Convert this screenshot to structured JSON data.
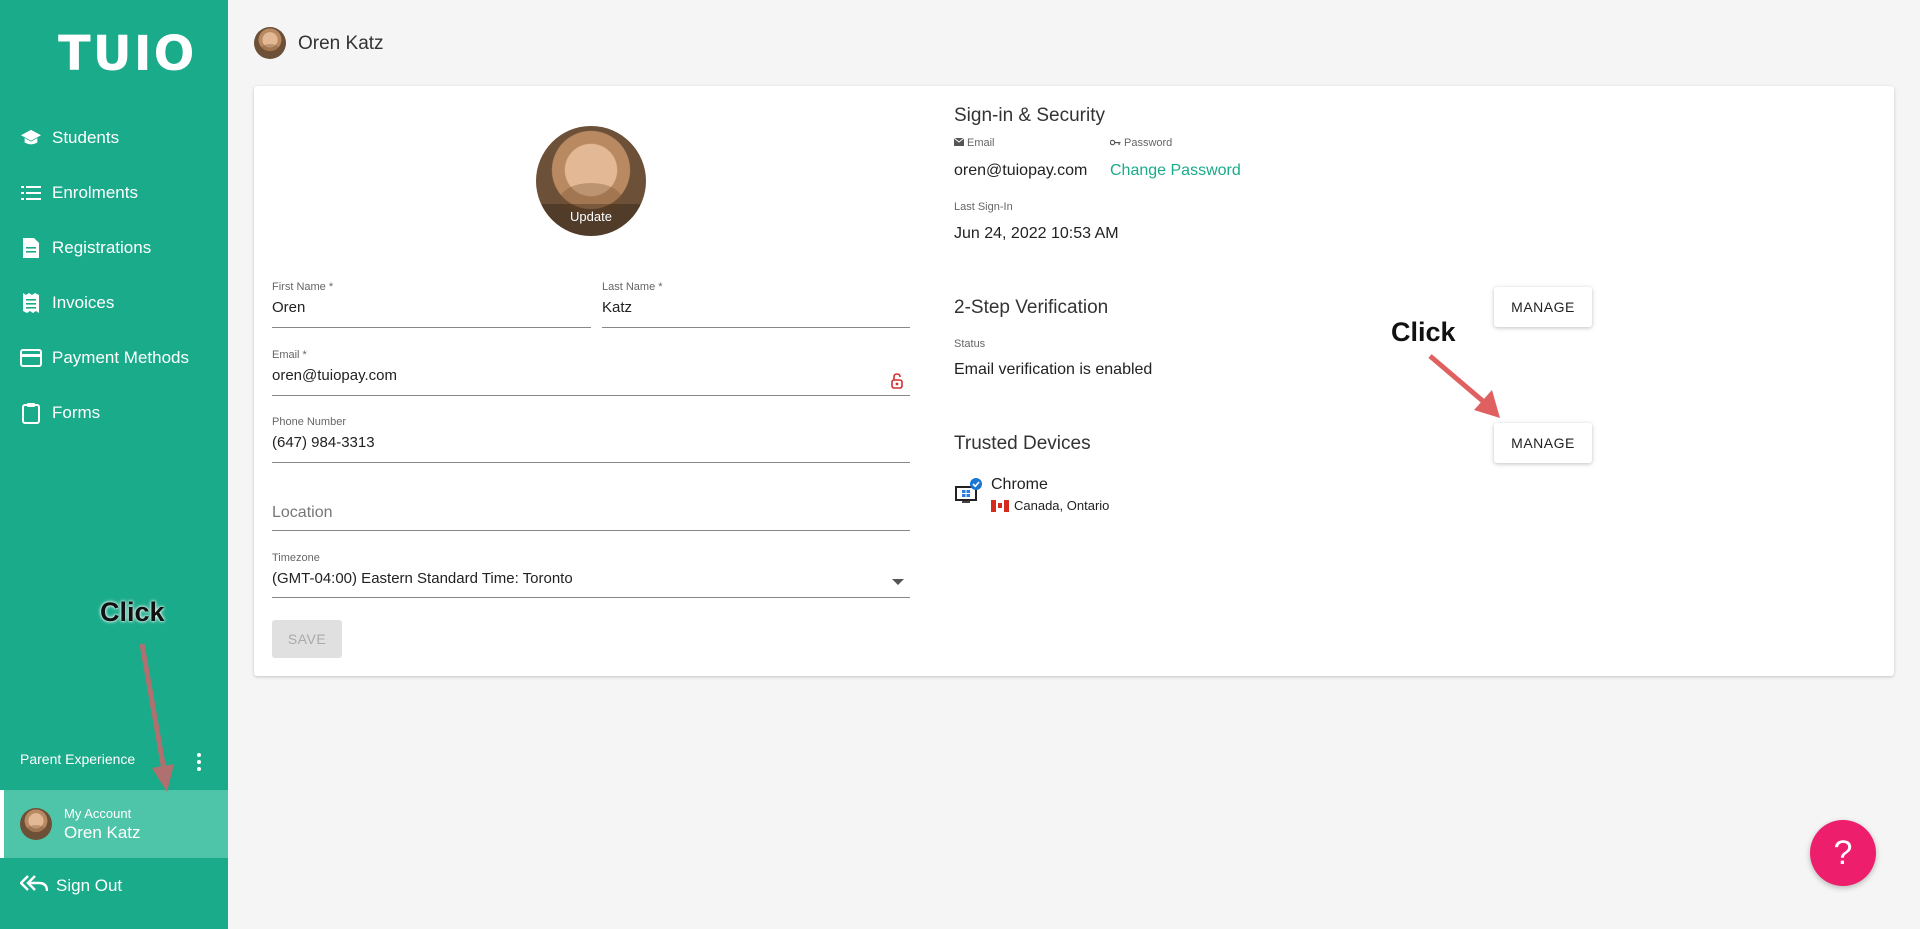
{
  "brand": {
    "logo": "TUIO"
  },
  "sidebar": {
    "items": [
      {
        "label": "Students",
        "icon": "graduation-cap-icon"
      },
      {
        "label": "Enrolments",
        "icon": "list-icon"
      },
      {
        "label": "Registrations",
        "icon": "document-icon"
      },
      {
        "label": "Invoices",
        "icon": "receipt-icon"
      },
      {
        "label": "Payment Methods",
        "icon": "credit-card-icon"
      },
      {
        "label": "Forms",
        "icon": "clipboard-icon"
      }
    ],
    "parent_experience": "Parent Experience",
    "account": {
      "caption": "My Account",
      "name": "Oren Katz"
    },
    "sign_out": "Sign Out"
  },
  "header": {
    "name": "Oren Katz"
  },
  "profile": {
    "update_label": "Update",
    "first_name": {
      "label": "First Name *",
      "value": "Oren"
    },
    "last_name": {
      "label": "Last Name *",
      "value": "Katz"
    },
    "email": {
      "label": "Email *",
      "value": "oren@tuiopay.com"
    },
    "phone": {
      "label": "Phone Number",
      "value": "(647) 984-3313"
    },
    "location": {
      "placeholder": "Location"
    },
    "timezone": {
      "label": "Timezone",
      "value": "(GMT-04:00) Eastern Standard Time: Toronto"
    },
    "save_label": "SAVE"
  },
  "security": {
    "title": "Sign-in & Security",
    "email_label": "Email",
    "email_value": "oren@tuiopay.com",
    "password_label": "Password",
    "change_password": "Change Password",
    "last_signin_label": "Last Sign-In",
    "last_signin_value": "Jun 24, 2022 10:53 AM"
  },
  "two_step": {
    "title": "2-Step Verification",
    "manage_label": "MANAGE",
    "status_label": "Status",
    "status_value": "Email verification is enabled"
  },
  "trusted_devices": {
    "title": "Trusted Devices",
    "manage_label": "MANAGE",
    "devices": [
      {
        "name": "Chrome",
        "location": "Canada, Ontario"
      }
    ]
  },
  "annotations": {
    "click_1": "Click",
    "click_2": "Click"
  },
  "help": {
    "label": "?"
  },
  "colors": {
    "brand": "#1aab8a",
    "help": "#ed1e6c",
    "arrow": "#e06060"
  }
}
